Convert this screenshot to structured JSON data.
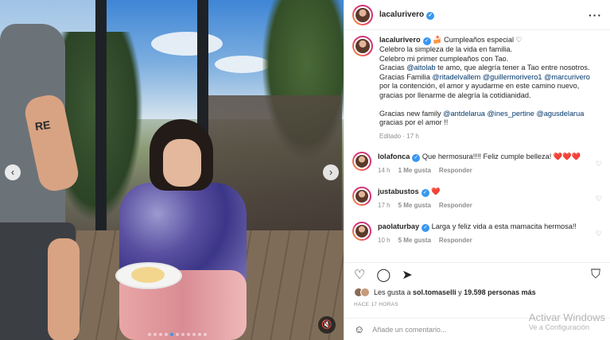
{
  "post": {
    "username": "lacalurivero",
    "caption_lines": [
      "🍰 Cumpleaños especial ♡",
      "Celebro la simpleza de la vida en familia.",
      "Celebro mi primer cumpleaños con Tao."
    ],
    "caption_p2_a": "Gracias ",
    "mention_aitolab": "@aitolab",
    "caption_p2_b": " te amo, que alegría tener a Tao entre nosotros.",
    "caption_p3_a": "Gracias Familia ",
    "mention_ritadelvallem": "@ritadelvallem",
    "mention_guillermorivero1": "@guillermorivero1",
    "mention_marcurivero": "@marcurivero",
    "caption_p3_b": "por la contención, el amor y ayudarme en este camino nuevo, gracias por llenarme de alegría la cotidianidad.",
    "caption_p4_a": "Gracias new family ",
    "mention_antdelarua": "@antdelarua",
    "mention_ines_pertine": "@ines_pertine",
    "mention_agusdelarua": "@agusdelarua",
    "caption_p4_b": "gracias por el amor !!",
    "edited": "Editado · 17 h"
  },
  "media": {
    "tattoo": "RE"
  },
  "comments": [
    {
      "user": "lolafonca",
      "text": "Que hermosura!!!! Feliz cumple belleza!",
      "hearts": "❤️❤️❤️",
      "time": "14 h",
      "likes": "1 Me gusta",
      "reply": "Responder"
    },
    {
      "user": "justabustos",
      "text": "",
      "hearts": "❤️",
      "time": "17 h",
      "likes": "5 Me gusta",
      "reply": "Responder"
    },
    {
      "user": "paolaturbay",
      "text": "Larga y feliz vida a esta mamacita hermosa!!",
      "hearts": "",
      "time": "10 h",
      "likes": "5 Me gusta",
      "reply": "Responder"
    }
  ],
  "likes": {
    "text_a": "Les gusta a ",
    "user": "sol.tomaselli",
    "text_b": " y ",
    "count": "19.598 personas más"
  },
  "time_ago": "HACE 17 HORAS",
  "add_comment": {
    "placeholder": "Añade un comentario..."
  },
  "watermark": {
    "line1": "Activar Windows",
    "line2": "Ve a Configuración"
  },
  "colors": {
    "accent": "#3897f0",
    "link": "#00376b",
    "heart": "#ed4956"
  }
}
